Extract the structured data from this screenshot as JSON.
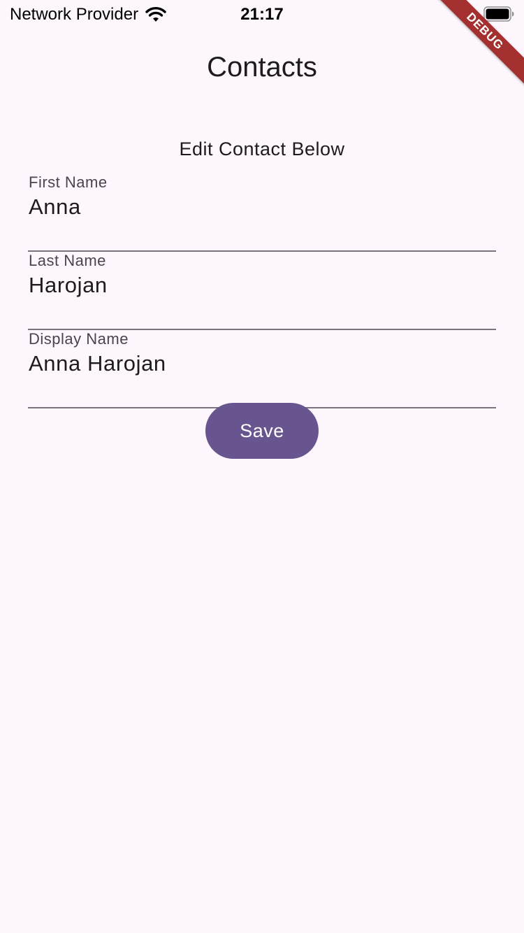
{
  "status_bar": {
    "carrier": "Network Provider",
    "time": "21:17",
    "wifi_icon": "wifi-icon",
    "battery_icon": "battery-icon"
  },
  "debug_banner": "DEBUG",
  "app_bar": {
    "title": "Contacts"
  },
  "form": {
    "heading": "Edit Contact Below",
    "fields": [
      {
        "label": "First Name",
        "value": "Anna"
      },
      {
        "label": "Last Name",
        "value": "Harojan"
      },
      {
        "label": "Display Name",
        "value": "Anna Harojan"
      }
    ],
    "save_label": "Save"
  },
  "colors": {
    "background": "#fdf7fd",
    "primary": "#68548e",
    "field_underline": "#79747e",
    "label": "#49454f",
    "debug_banner": "#a3302f"
  }
}
